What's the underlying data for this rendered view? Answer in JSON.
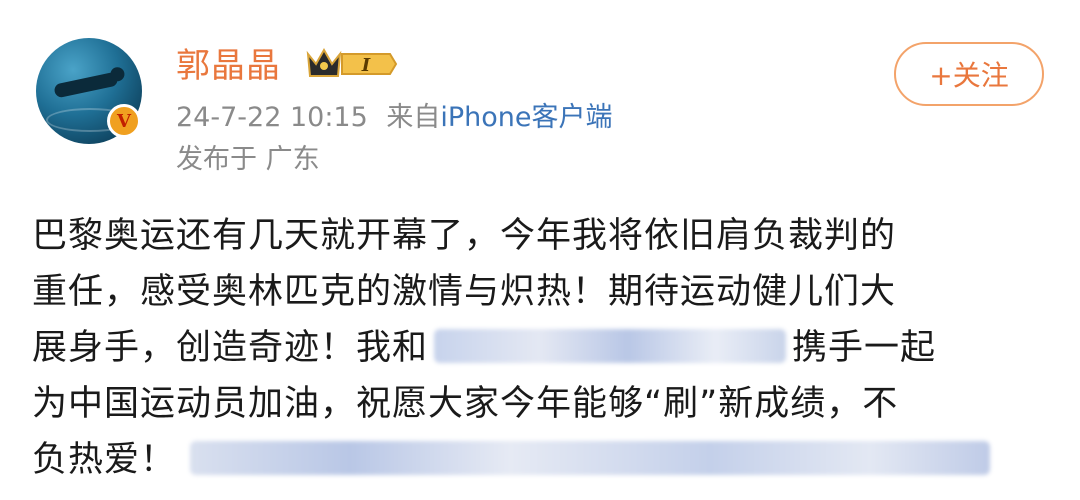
{
  "user": {
    "name": "郭晶晶",
    "vip_level": "I",
    "verified_icon": "verified-v-icon",
    "timestamp": "24-7-22 10:15",
    "source_prefix": "来自",
    "source_app": "iPhone客户端",
    "location": "发布于 广东"
  },
  "actions": {
    "follow_label": "+关注"
  },
  "post": {
    "line1": "巴黎奥运还有几天就开幕了，今年我将依旧肩负裁判的",
    "line2": "重任，感受奥林匹克的激情与炽热！期待运动健儿们大",
    "line3_before": "展身手，创造奇迹！我和",
    "line3_after": "携手一起",
    "line4": "为中国运动员加油，祝愿大家今年能够“刷”新成绩，不",
    "line5": "负热爱！"
  },
  "colors": {
    "name": "#e9773d",
    "link": "#3b74b8",
    "meta": "#8a8a8a"
  }
}
